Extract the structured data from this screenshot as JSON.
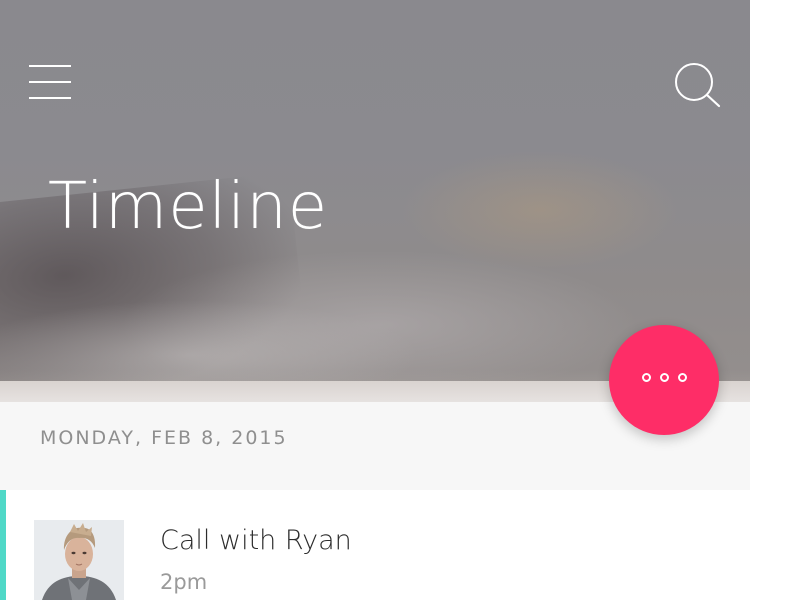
{
  "header": {
    "title": "Timeline",
    "menu_icon": "hamburger-menu-icon",
    "search_icon": "search-icon"
  },
  "date_heading": "MONDAY, FEB 8, 2015",
  "fab": {
    "icon": "more-options-icon",
    "color": "#fe2d67"
  },
  "events": [
    {
      "title": "Call with Ryan",
      "time": "2pm",
      "accent_color": "#4fd8c7"
    }
  ]
}
